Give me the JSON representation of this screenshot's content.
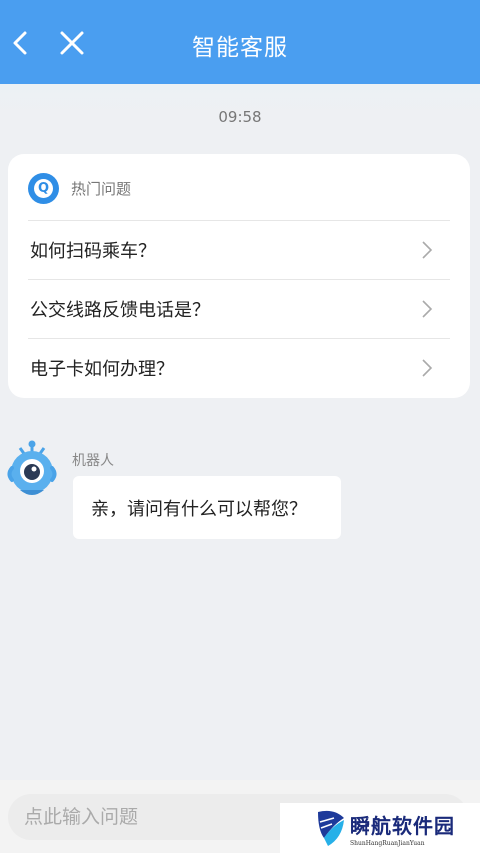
{
  "header": {
    "title": "智能客服",
    "back_icon": "chevron-left-icon",
    "close_icon": "close-icon",
    "bg_color": "#4a9ef0"
  },
  "chat": {
    "timestamp": "09:58"
  },
  "hot_questions": {
    "label": "热门问题",
    "icon": "q-icon",
    "items": [
      {
        "text": "如何扫码乘车？"
      },
      {
        "text": "公交线路反馈电话是？"
      },
      {
        "text": "电子卡如何办理？"
      }
    ]
  },
  "bot_message": {
    "sender": "机器人",
    "text": "亲，请问有什么可以帮您？"
  },
  "input": {
    "placeholder": "点此输入问题",
    "value": ""
  },
  "watermark": {
    "title": "瞬航软件园",
    "subtitle": "ShunHangRuanJianYuan"
  }
}
